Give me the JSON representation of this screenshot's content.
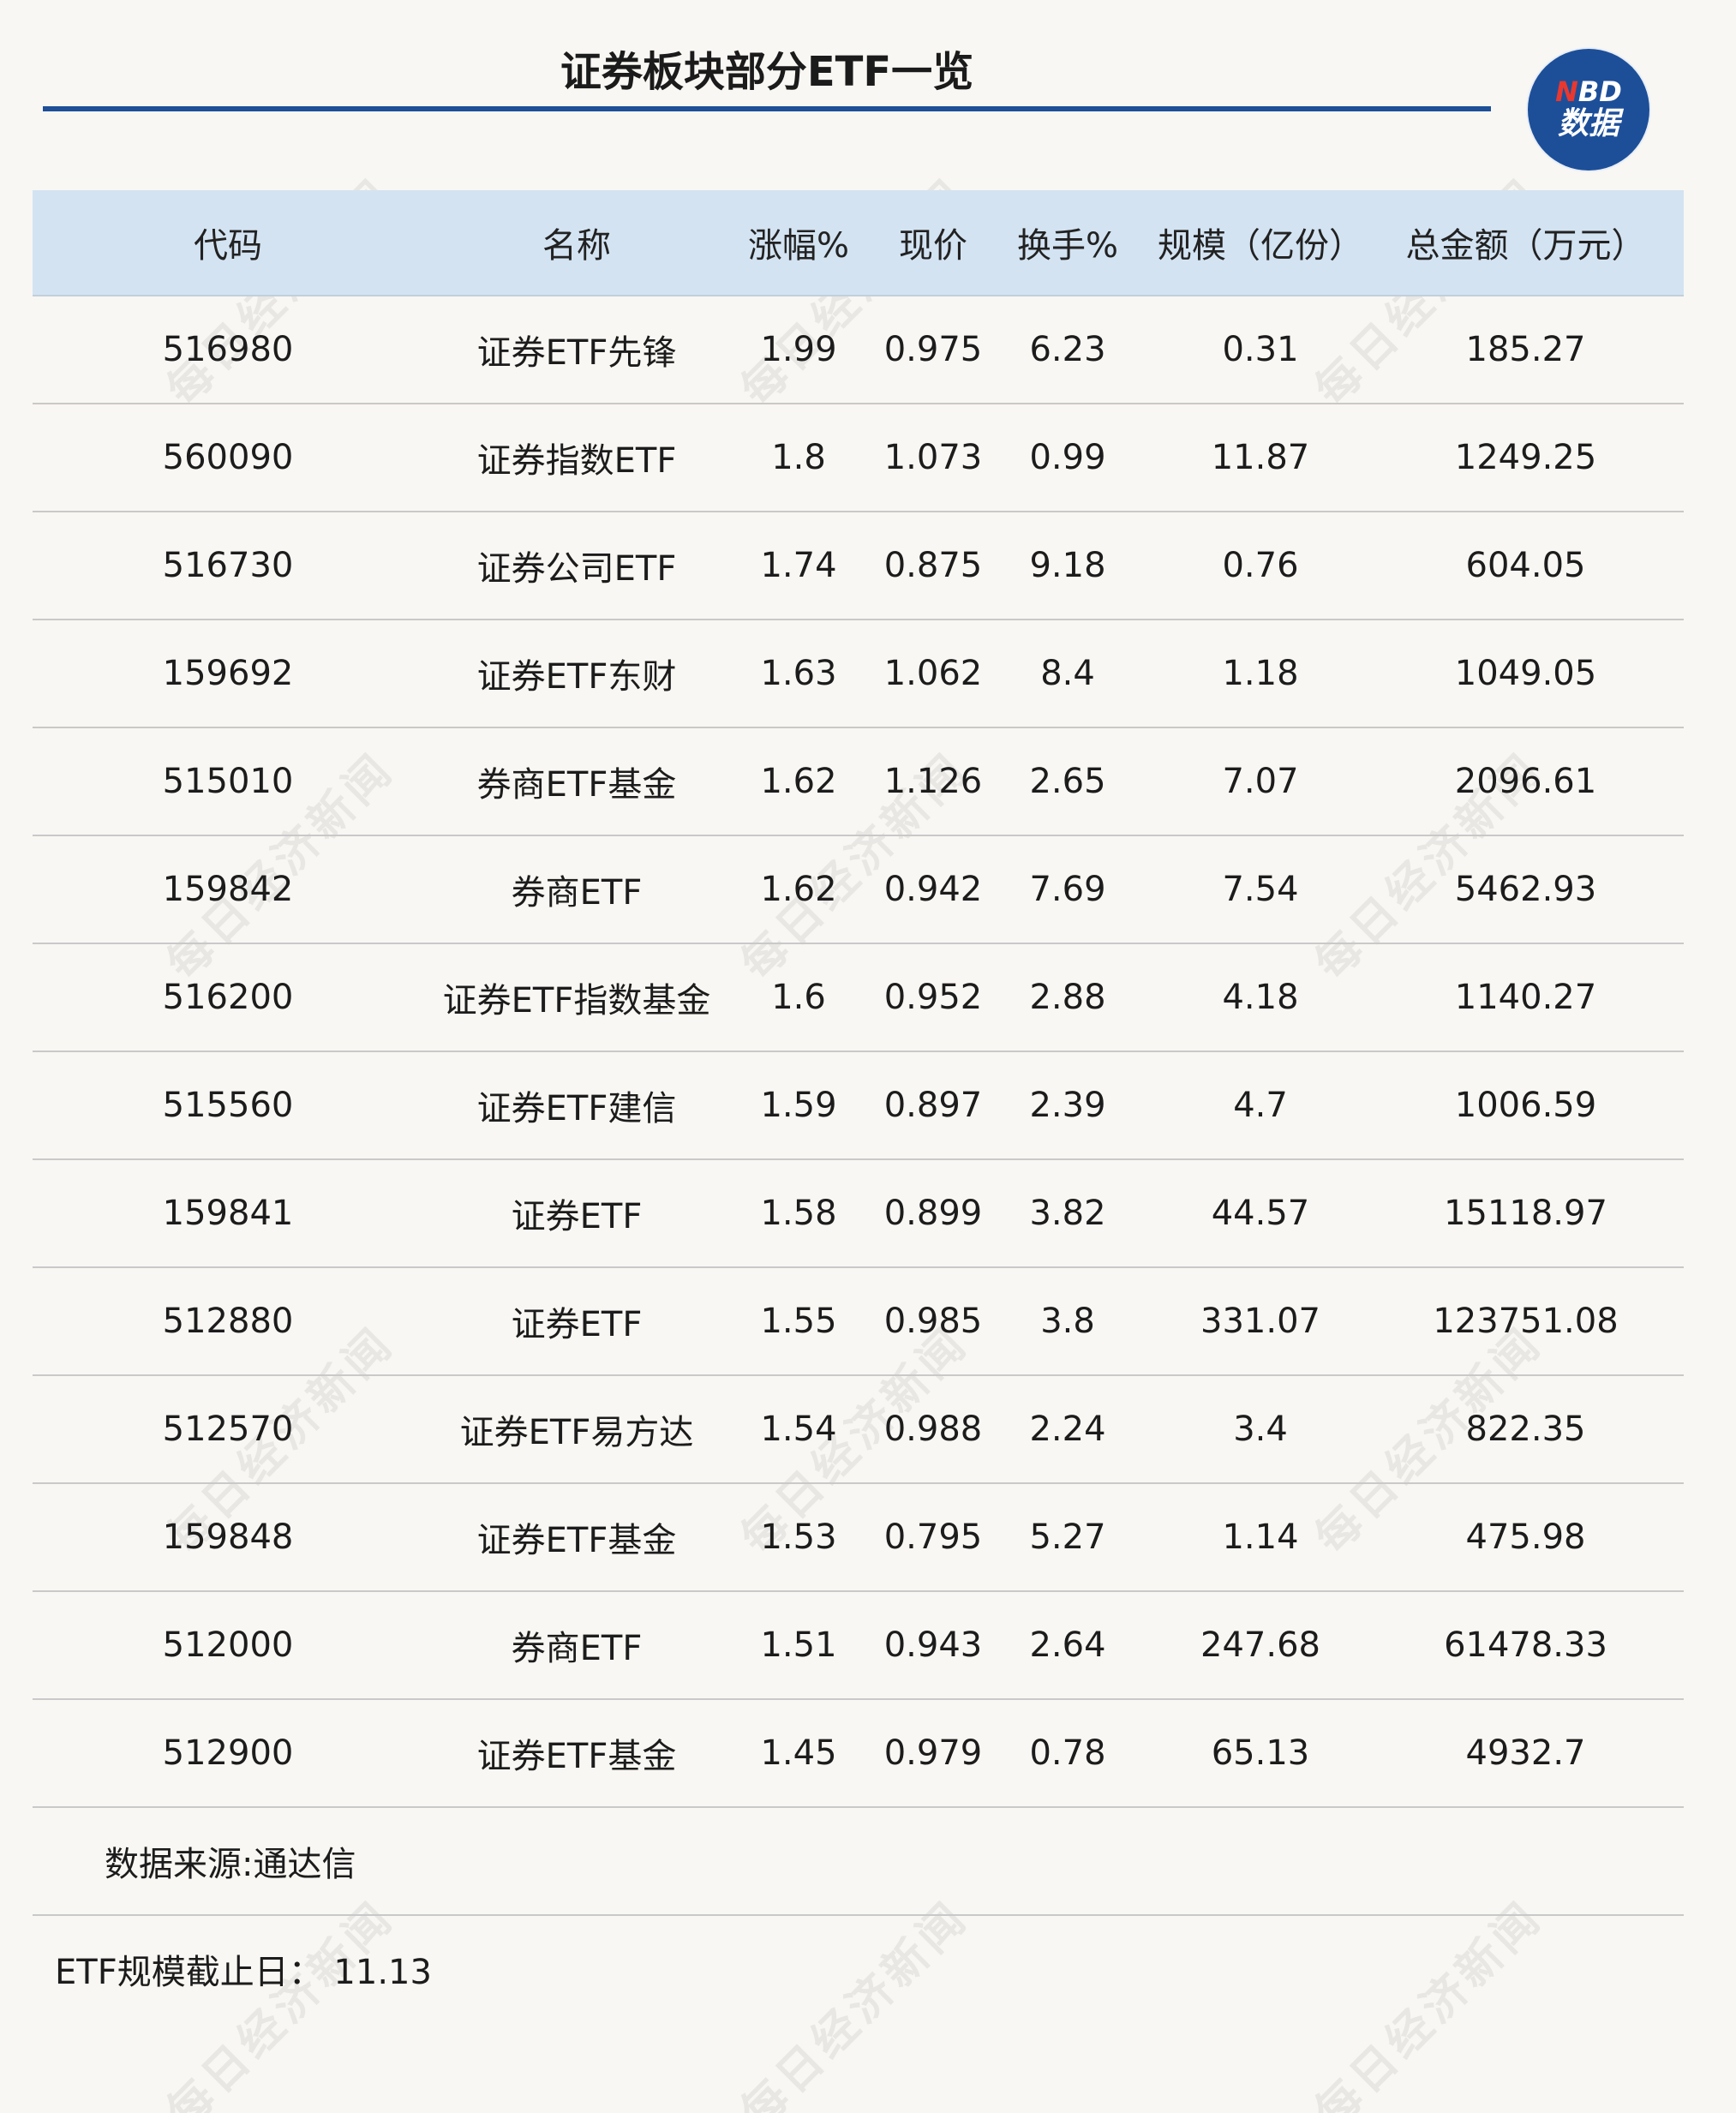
{
  "title": "证券板块部分ETF一览",
  "logo": {
    "line1_n": "N",
    "line1_rest": "BD",
    "line2": "数据"
  },
  "watermark_text": "每日经济新闻",
  "table": {
    "headers": [
      "代码",
      "名称",
      "涨幅%",
      "现价",
      "换手%",
      "规模（亿份）",
      "总金额（万元）"
    ],
    "rows": [
      [
        "516980",
        "证券ETF先锋",
        "1.99",
        "0.975",
        "6.23",
        "0.31",
        "185.27"
      ],
      [
        "560090",
        "证券指数ETF",
        "1.8",
        "1.073",
        "0.99",
        "11.87",
        "1249.25"
      ],
      [
        "516730",
        "证券公司ETF",
        "1.74",
        "0.875",
        "9.18",
        "0.76",
        "604.05"
      ],
      [
        "159692",
        "证券ETF东财",
        "1.63",
        "1.062",
        "8.4",
        "1.18",
        "1049.05"
      ],
      [
        "515010",
        "券商ETF基金",
        "1.62",
        "1.126",
        "2.65",
        "7.07",
        "2096.61"
      ],
      [
        "159842",
        "券商ETF",
        "1.62",
        "0.942",
        "7.69",
        "7.54",
        "5462.93"
      ],
      [
        "516200",
        "证券ETF指数基金",
        "1.6",
        "0.952",
        "2.88",
        "4.18",
        "1140.27"
      ],
      [
        "515560",
        "证券ETF建信",
        "1.59",
        "0.897",
        "2.39",
        "4.7",
        "1006.59"
      ],
      [
        "159841",
        "证券ETF",
        "1.58",
        "0.899",
        "3.82",
        "44.57",
        "15118.97"
      ],
      [
        "512880",
        "证券ETF",
        "1.55",
        "0.985",
        "3.8",
        "331.07",
        "123751.08"
      ],
      [
        "512570",
        "证券ETF易方达",
        "1.54",
        "0.988",
        "2.24",
        "3.4",
        "822.35"
      ],
      [
        "159848",
        "证券ETF基金",
        "1.53",
        "0.795",
        "5.27",
        "1.14",
        "475.98"
      ],
      [
        "512000",
        "券商ETF",
        "1.51",
        "0.943",
        "2.64",
        "247.68",
        "61478.33"
      ],
      [
        "512900",
        "证券ETF基金",
        "1.45",
        "0.979",
        "0.78",
        "65.13",
        "4932.7"
      ]
    ]
  },
  "source": "数据来源:通达信",
  "scale_date": "ETF规模截止日：  11.13",
  "colors": {
    "accent": "#1e4f98",
    "header_bg": "#d3e3f2",
    "page_bg": "#f9f7f3",
    "logo_red": "#e8382f"
  }
}
